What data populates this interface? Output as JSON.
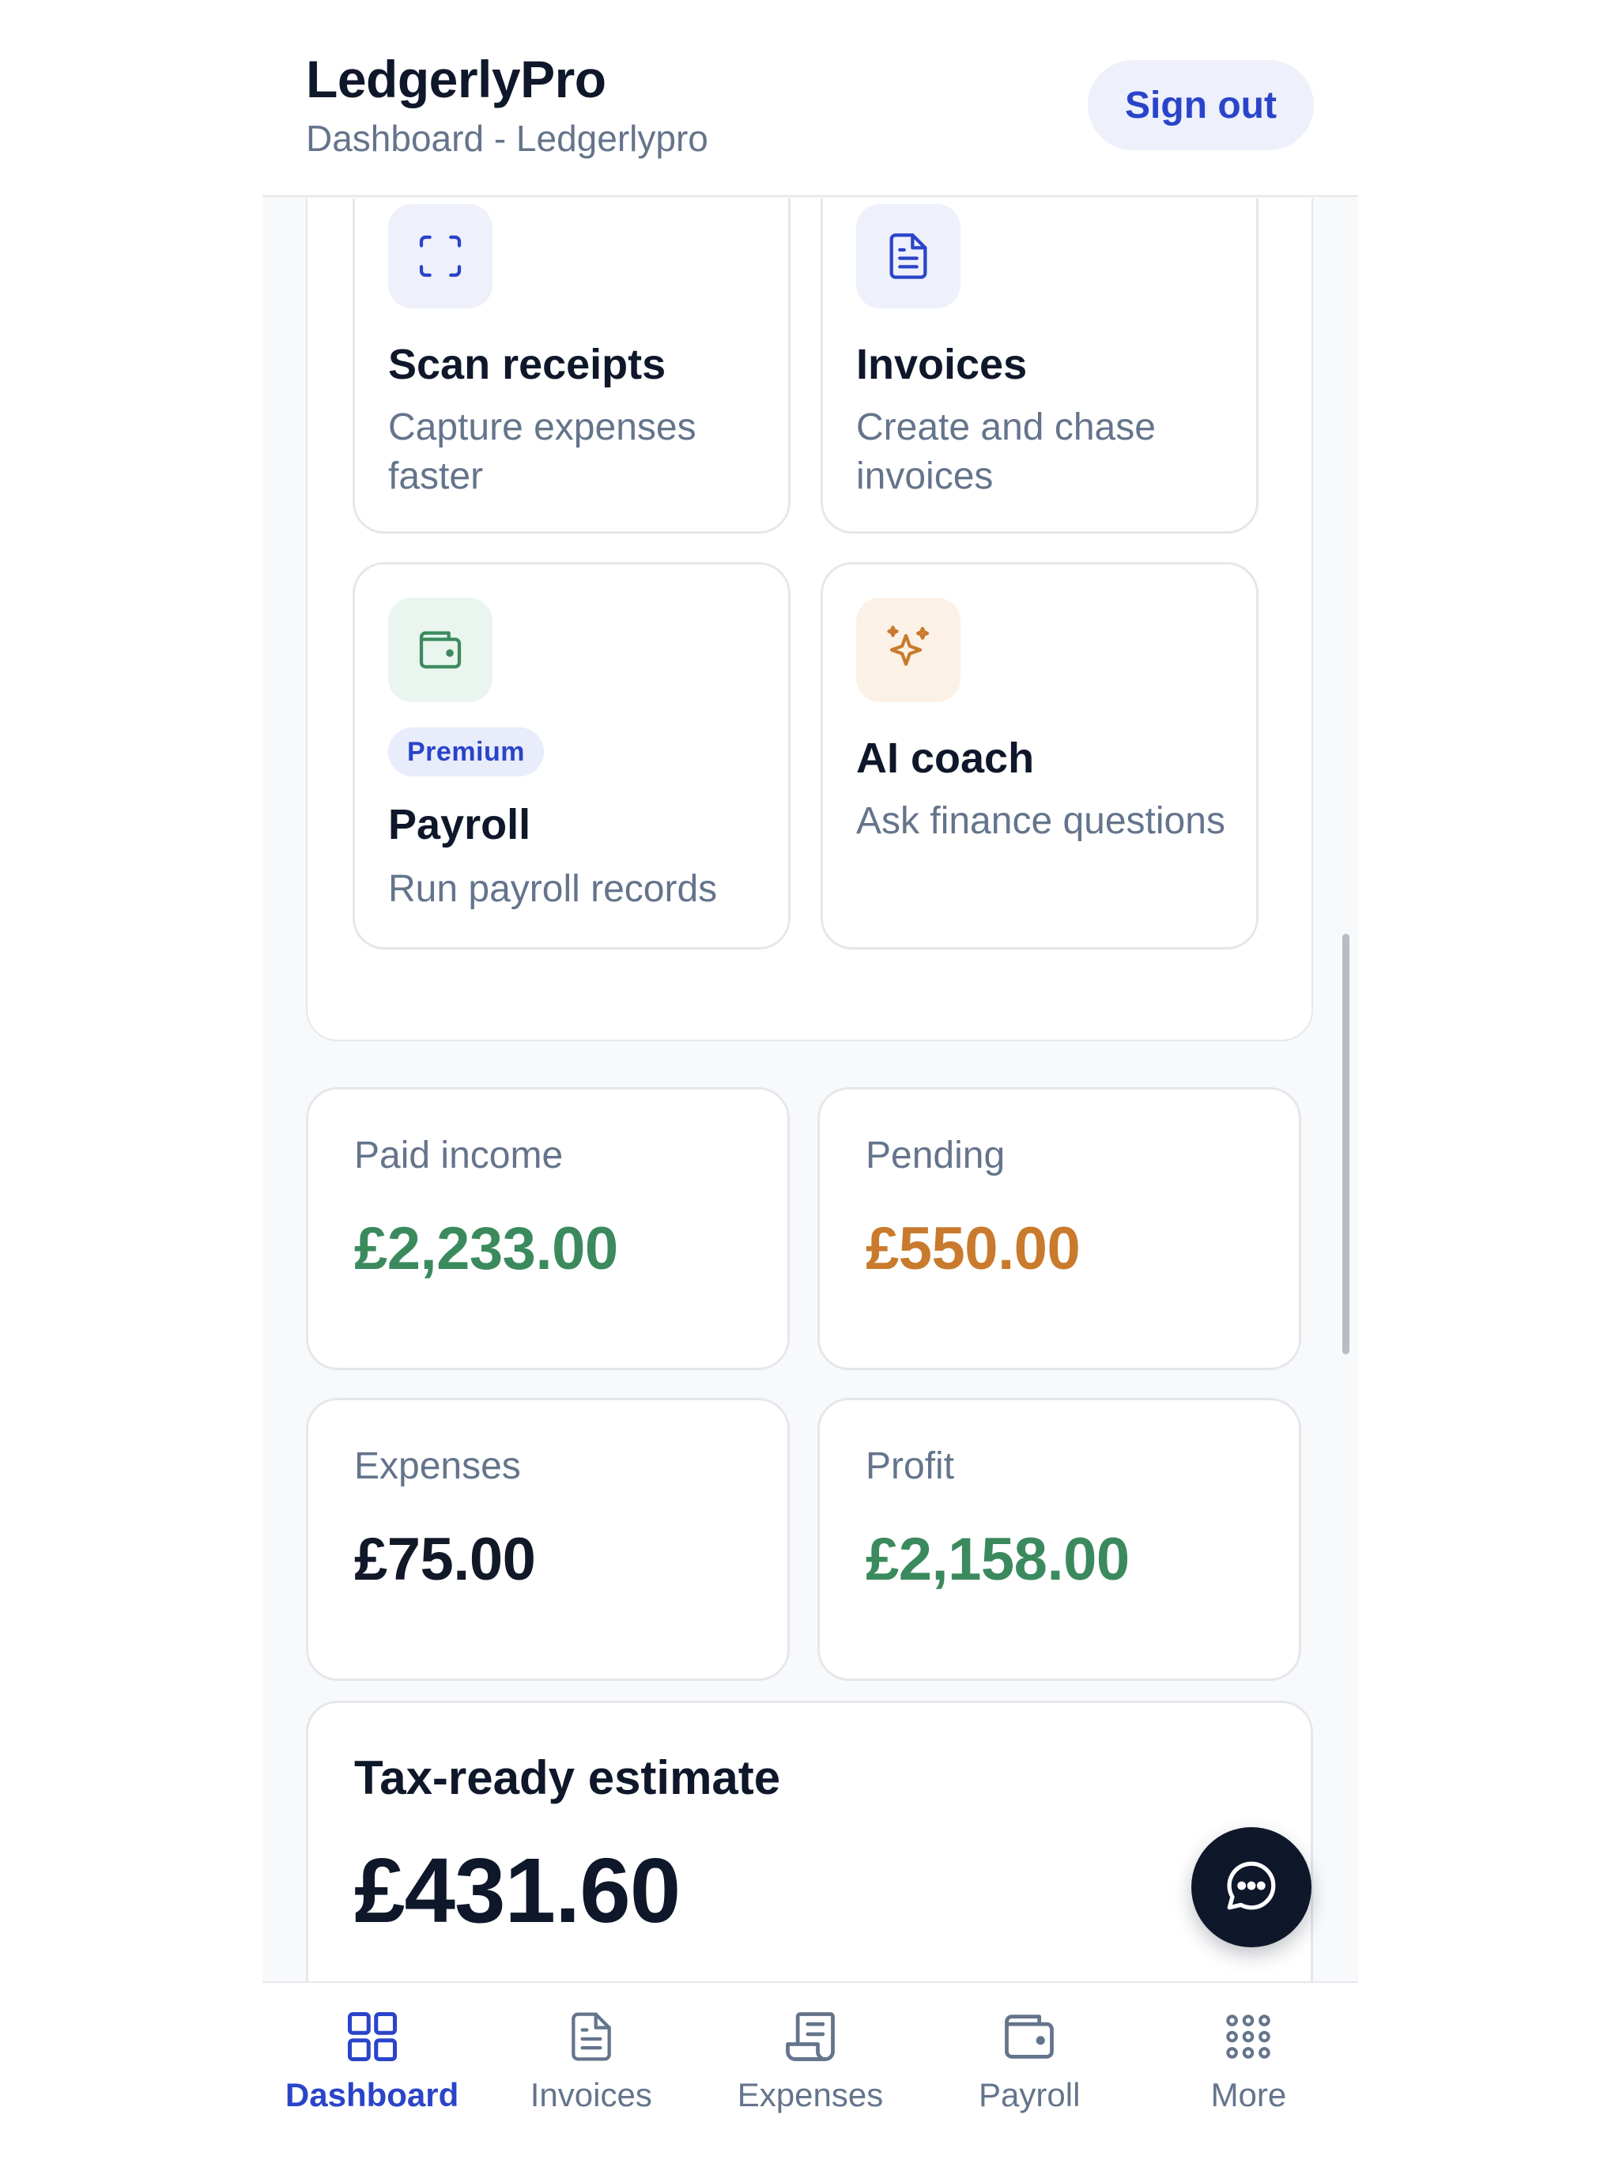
{
  "header": {
    "title": "LedgerlyPro",
    "subtitle": "Dashboard - Ledgerlypro",
    "sign_out_label": "Sign out"
  },
  "quick_actions": [
    {
      "title": "Scan receipts",
      "desc": "Capture expenses faster",
      "icon": "scan-icon",
      "color": "#2a44c9",
      "bg": "#eef0fb"
    },
    {
      "title": "Invoices",
      "desc": "Create and chase invoices",
      "icon": "document-icon",
      "color": "#2a44c9",
      "bg": "#eef0fb"
    },
    {
      "title": "Payroll",
      "desc": "Run payroll records",
      "badge": "Premium",
      "icon": "wallet-icon",
      "color": "#3b8a5e",
      "bg": "#e9f5ee"
    },
    {
      "title": "AI coach",
      "desc": "Ask finance questions",
      "icon": "sparkles-icon",
      "color": "#c97a2c",
      "bg": "#fcf1e6"
    }
  ],
  "stats": [
    {
      "label": "Paid income",
      "value": "£2,233.00",
      "color": "#3b8a5e"
    },
    {
      "label": "Pending",
      "value": "£550.00",
      "color": "#c97a2c"
    },
    {
      "label": "Expenses",
      "value": "£75.00",
      "color": "#111827"
    },
    {
      "label": "Profit",
      "value": "£2,158.00",
      "color": "#3b8a5e"
    }
  ],
  "tax": {
    "label": "Tax-ready estimate",
    "value": "£431.60"
  },
  "nav": [
    {
      "label": "Dashboard",
      "icon": "grid-icon",
      "active": true
    },
    {
      "label": "Invoices",
      "icon": "document-icon",
      "active": false
    },
    {
      "label": "Expenses",
      "icon": "receipt-icon",
      "active": false
    },
    {
      "label": "Payroll",
      "icon": "wallet-icon",
      "active": false
    },
    {
      "label": "More",
      "icon": "dots-grid-icon",
      "active": false
    }
  ],
  "colors": {
    "accent": "#2a44c9",
    "success": "#3b8a5e",
    "warning": "#c97a2c",
    "dark": "#0f172a",
    "muted": "#64748b"
  }
}
